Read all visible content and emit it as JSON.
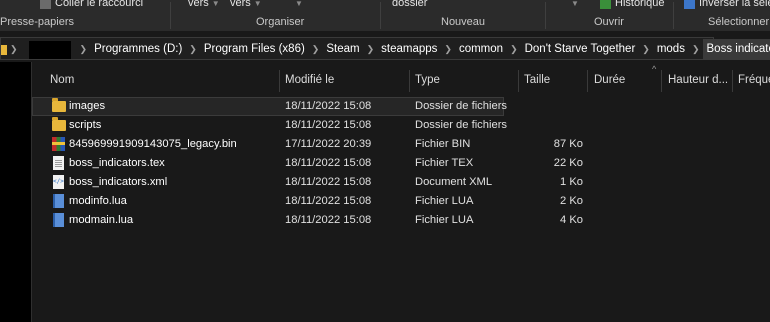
{
  "ribbon": {
    "top_items": {
      "paste_shortcut": "Coller le raccourci",
      "move_to": "vers",
      "copy_to": "vers",
      "new_folder": "dossier",
      "history": "Historique",
      "invert_selection": "Inverser la sélection"
    },
    "groups": {
      "clipboard": "Presse-papiers",
      "organize": "Organiser",
      "new": "Nouveau",
      "open": "Ouvrir",
      "select": "Sélectionner"
    }
  },
  "address": {
    "crumbs": [
      "Programmes (D:)",
      "Program Files (x86)",
      "Steam",
      "steamapps",
      "common",
      "Don't Starve Together",
      "mods",
      "Boss indicator"
    ]
  },
  "columns": {
    "name": "Nom",
    "modified": "Modifié le",
    "type": "Type",
    "size": "Taille",
    "duration": "Durée",
    "height": "Hauteur d...",
    "frequency": "Fréquence"
  },
  "files": [
    {
      "name": "images",
      "modified": "18/11/2022 15:08",
      "type": "Dossier de fichiers",
      "size": "",
      "icon": "folder-icon"
    },
    {
      "name": "scripts",
      "modified": "18/11/2022 15:08",
      "type": "Dossier de fichiers",
      "size": "",
      "icon": "folder-icon"
    },
    {
      "name": "845969991909143075_legacy.bin",
      "modified": "17/11/2022 20:39",
      "type": "Fichier BIN",
      "size": "87 Ko",
      "icon": "archive-icon"
    },
    {
      "name": "boss_indicators.tex",
      "modified": "18/11/2022 15:08",
      "type": "Fichier TEX",
      "size": "22 Ko",
      "icon": "document-icon"
    },
    {
      "name": "boss_indicators.xml",
      "modified": "18/11/2022 15:08",
      "type": "Document XML",
      "size": "1 Ko",
      "icon": "xml-file-icon"
    },
    {
      "name": "modinfo.lua",
      "modified": "18/11/2022 15:08",
      "type": "Fichier LUA",
      "size": "2 Ko",
      "icon": "lua-file-icon"
    },
    {
      "name": "modmain.lua",
      "modified": "18/11/2022 15:08",
      "type": "Fichier LUA",
      "size": "4 Ko",
      "icon": "lua-file-icon"
    }
  ],
  "colors": {
    "background": "#191919",
    "ribbon": "#2b2b2b",
    "folder": "#e8b73b",
    "selection": "#262626"
  }
}
